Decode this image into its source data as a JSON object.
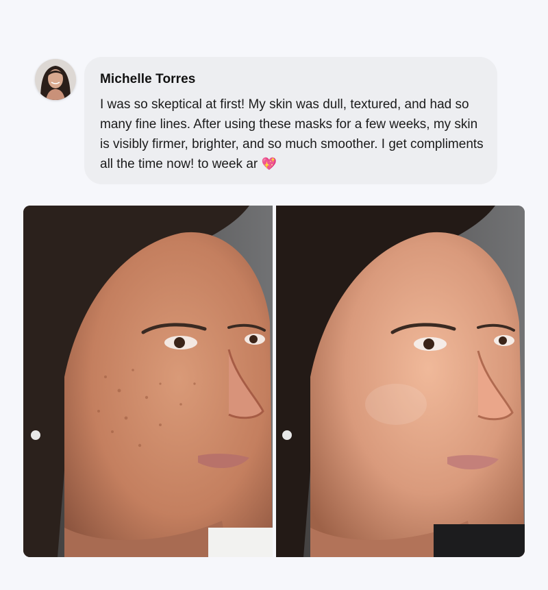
{
  "review": {
    "author_name": "Michelle Torres",
    "text": "I was so skeptical at first! My skin was dull, textured, and had so many fine lines. After using these masks for a few weeks, my skin is visibly firmer, brighter, and so much smoother. I get compliments all the time now! ",
    "trailing_text": "to week ar",
    "emoji": "💖"
  },
  "photos": {
    "before": {
      "label_icon": "face-photo-before"
    },
    "after": {
      "label_icon": "face-photo-after"
    }
  },
  "colors": {
    "background": "#f6f7fb",
    "bubble": "#edeef1",
    "text": "#1b1b1b"
  }
}
